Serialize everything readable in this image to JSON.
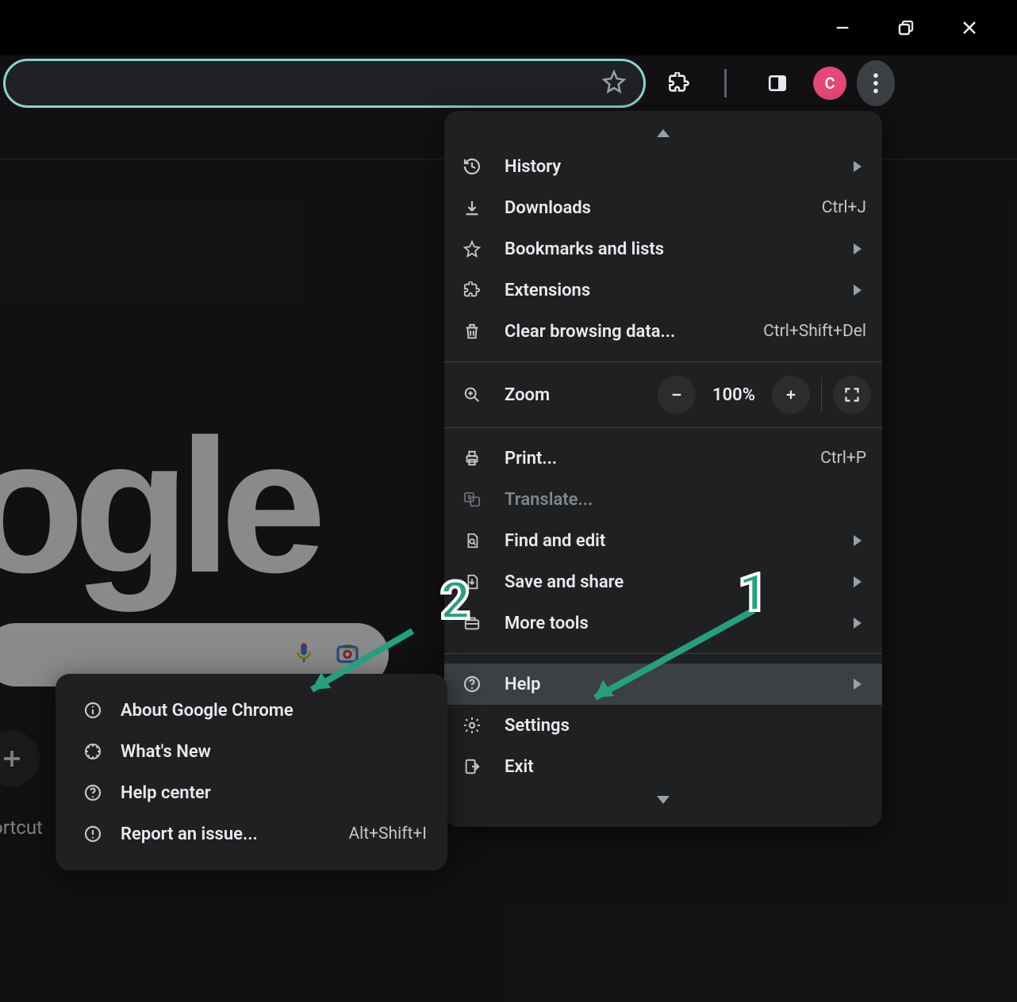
{
  "titlebar": {},
  "toolbar": {
    "profile_initial": "C"
  },
  "page": {
    "logo_text": "ogle",
    "shortcut_label": "ortcut"
  },
  "menu": {
    "history": "History",
    "downloads": "Downloads",
    "downloads_kbd": "Ctrl+J",
    "bookmarks": "Bookmarks and lists",
    "extensions": "Extensions",
    "clear_data": "Clear browsing data...",
    "clear_data_kbd": "Ctrl+Shift+Del",
    "zoom_label": "Zoom",
    "zoom_value": "100%",
    "print": "Print...",
    "print_kbd": "Ctrl+P",
    "translate": "Translate...",
    "find": "Find and edit",
    "save_share": "Save and share",
    "more_tools": "More tools",
    "help": "Help",
    "settings": "Settings",
    "exit": "Exit"
  },
  "help_submenu": {
    "about": "About Google Chrome",
    "whats_new": "What's New",
    "help_center": "Help center",
    "report": "Report an issue...",
    "report_kbd": "Alt+Shift+I"
  },
  "annotations": {
    "one": "1",
    "two": "2"
  }
}
